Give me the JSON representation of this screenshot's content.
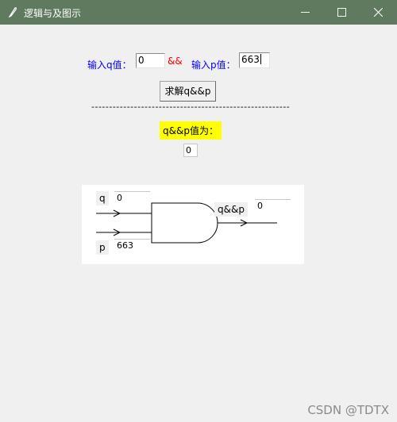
{
  "window": {
    "title": "逻辑与及图示",
    "title_bar_color": "#5f7a5f"
  },
  "form": {
    "q_label": "输入q值：",
    "q_value": "0",
    "and_operator": "&&",
    "p_label": "输入p值：",
    "p_value": "663",
    "solve_button": "求解q&&p",
    "separator": "--------------------------------------------------------",
    "result_label": "q&&p值为：",
    "result_value": "0",
    "label_color": "#0000ff",
    "operator_color": "#ff0000",
    "result_highlight": "#ffff00"
  },
  "diagram": {
    "q_label": "q",
    "q_value": "0",
    "p_label": "p",
    "p_value": "663",
    "output_label": "q&&p",
    "output_value": "0"
  },
  "watermark": "CSDN @TDTX",
  "icons": {
    "app": "feather-icon",
    "minimize": "minimize-icon",
    "maximize": "maximize-icon",
    "close": "close-icon"
  }
}
